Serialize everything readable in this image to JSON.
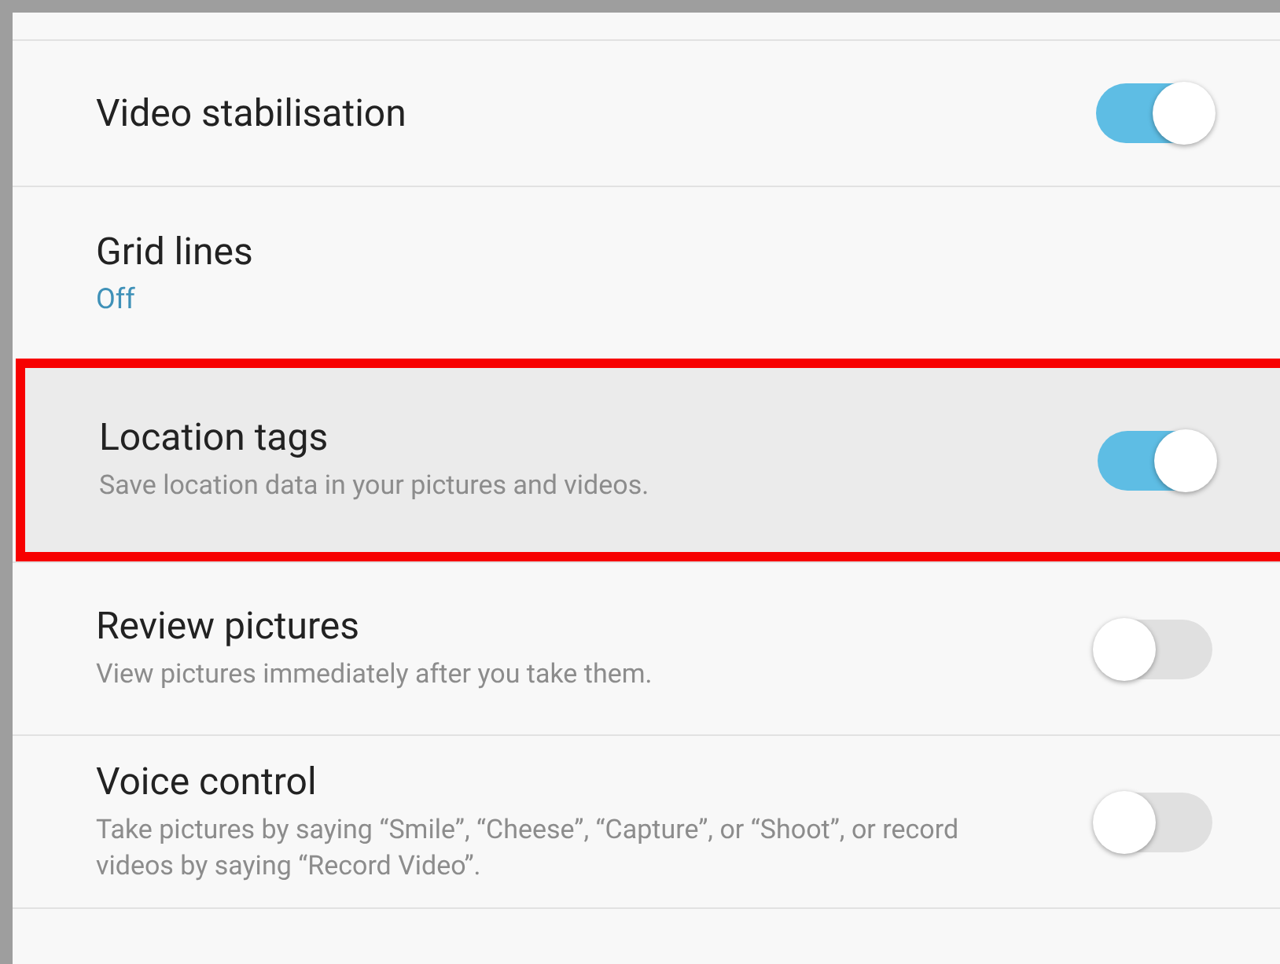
{
  "settings": [
    {
      "title": "Video stabilisation",
      "on": true,
      "highlighted": false
    },
    {
      "title": "Grid lines",
      "value": "Off",
      "highlighted": false
    },
    {
      "title": "Location tags",
      "subtitle": "Save location data in your pictures and videos.",
      "on": true,
      "highlighted": true
    },
    {
      "title": "Review pictures",
      "subtitle": "View pictures immediately after you take them.",
      "on": false,
      "highlighted": false
    },
    {
      "title": "Voice control",
      "subtitle": "Take pictures by saying “Smile”, “Cheese”, “Capture”, or “Shoot”, or record videos by saying “Record Video”.",
      "on": false,
      "highlighted": false
    }
  ]
}
